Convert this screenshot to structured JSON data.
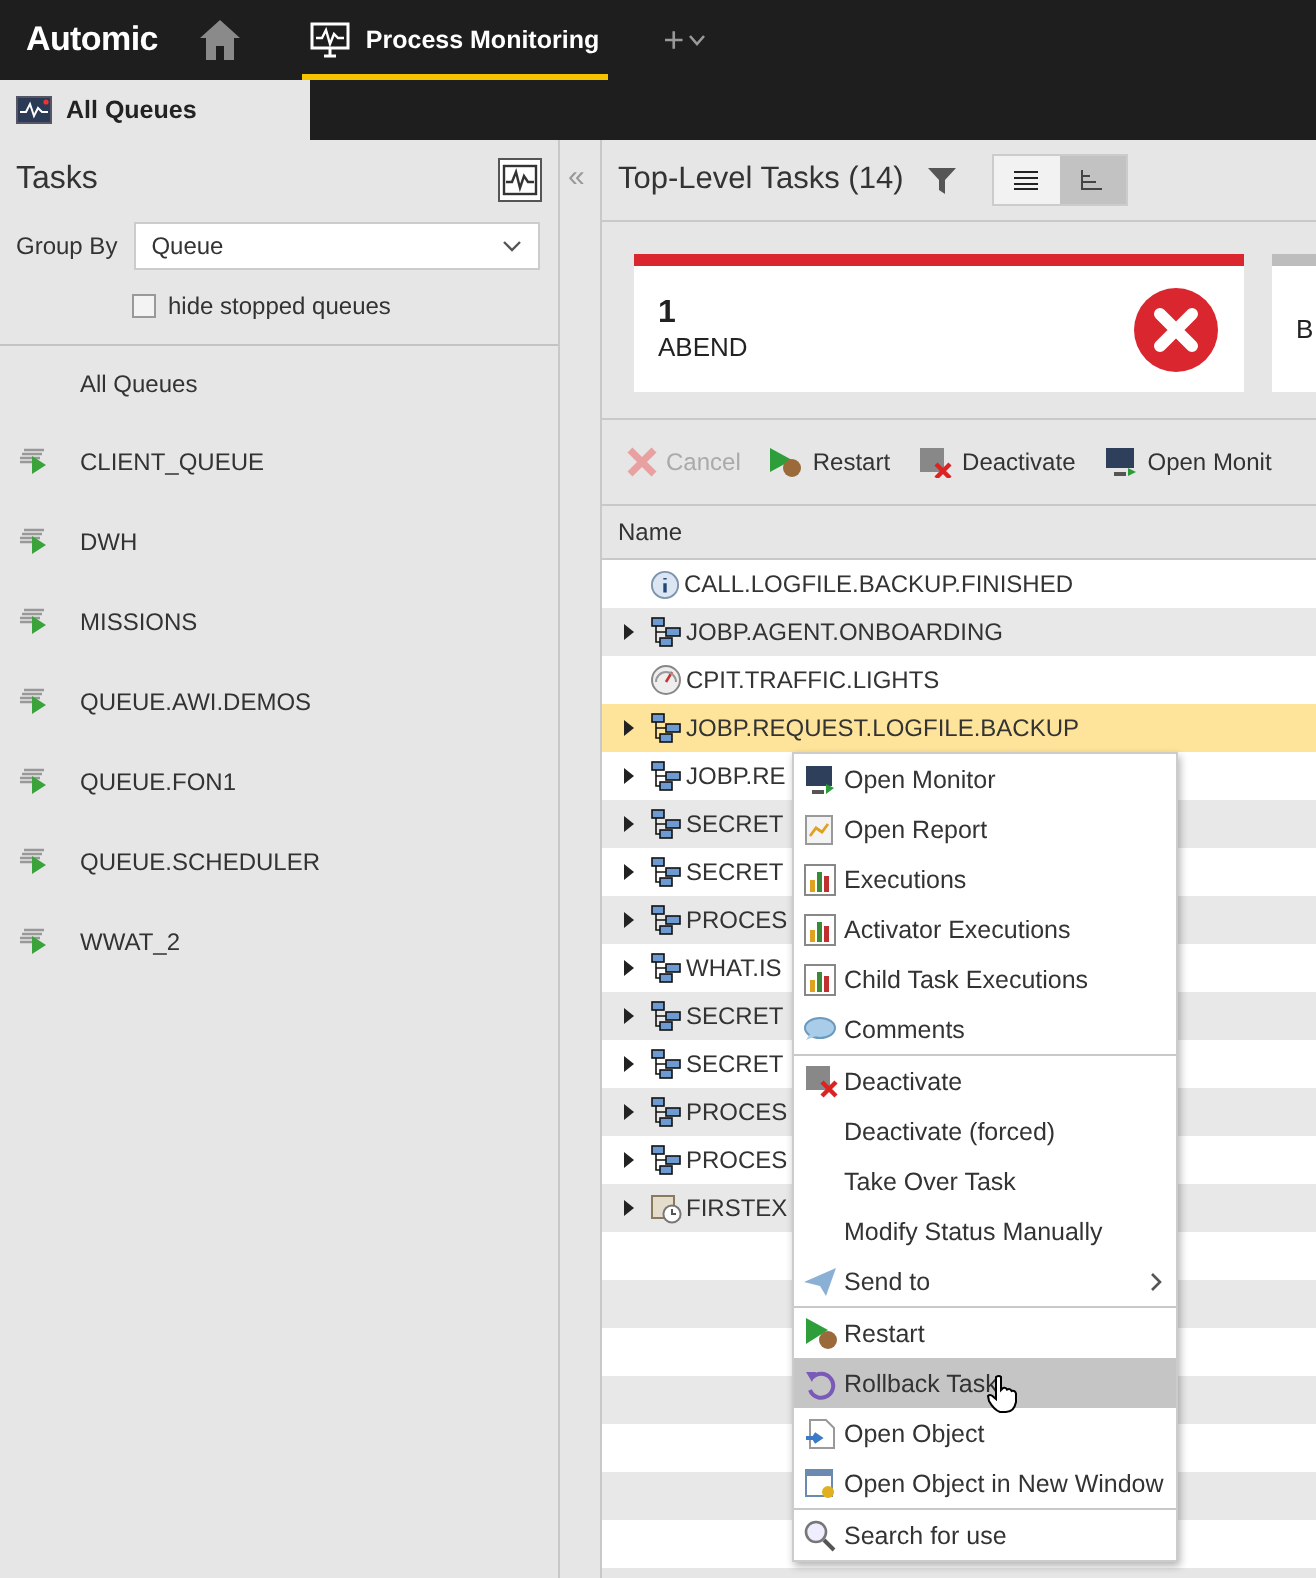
{
  "topbar": {
    "logo": "Automic",
    "tabs": [
      {
        "label": "Process Monitoring",
        "selected": true
      }
    ],
    "add": "+"
  },
  "view_tab": {
    "label": "All Queues",
    "selected": true
  },
  "left": {
    "title": "Tasks",
    "group_by_label": "Group By",
    "group_by_value": "Queue",
    "hide_stopped": {
      "label": "hide stopped queues",
      "checked": false
    },
    "queues": [
      {
        "label": "All Queues",
        "kind": "all"
      },
      {
        "label": "CLIENT_QUEUE",
        "kind": "queue"
      },
      {
        "label": "DWH",
        "kind": "queue"
      },
      {
        "label": "MISSIONS",
        "kind": "queue"
      },
      {
        "label": "QUEUE.AWI.DEMOS",
        "kind": "queue"
      },
      {
        "label": "QUEUE.FON1",
        "kind": "queue"
      },
      {
        "label": "QUEUE.SCHEDULER",
        "kind": "queue"
      },
      {
        "label": "WWAT_2",
        "kind": "queue"
      }
    ]
  },
  "collapse": "«",
  "right": {
    "title": "Top-Level Tasks (14)",
    "views": [
      {
        "kind": "list",
        "selected": false
      },
      {
        "kind": "tree",
        "selected": true
      }
    ],
    "cards": [
      {
        "count": "1",
        "label": "ABEND",
        "kind": "abend"
      },
      {
        "label": "B",
        "kind": "other"
      }
    ],
    "toolbar": [
      {
        "label": "Cancel",
        "kind": "cancel",
        "disabled": true
      },
      {
        "label": "Restart",
        "kind": "restart",
        "disabled": false
      },
      {
        "label": "Deactivate",
        "kind": "deactivate",
        "disabled": false
      },
      {
        "label": "Open Monit",
        "kind": "monitor",
        "disabled": false
      }
    ],
    "column": "Name",
    "rows": [
      {
        "name": "CALL.LOGFILE.BACKUP.FINISHED",
        "kind": "info",
        "expandable": false,
        "selected": false
      },
      {
        "name": "JOBP.AGENT.ONBOARDING",
        "kind": "workflow",
        "expandable": true,
        "selected": false
      },
      {
        "name": "CPIT.TRAFFIC.LIGHTS",
        "kind": "gauge",
        "expandable": false,
        "selected": false
      },
      {
        "name": "JOBP.REQUEST.LOGFILE.BACKUP",
        "kind": "workflow",
        "expandable": true,
        "selected": true
      },
      {
        "name": "JOBP.RE",
        "kind": "workflow",
        "expandable": true,
        "selected": false
      },
      {
        "name": "SECRET",
        "kind": "workflow",
        "expandable": true,
        "selected": false
      },
      {
        "name": "SECRET",
        "kind": "workflow",
        "expandable": true,
        "selected": false
      },
      {
        "name": "PROCES",
        "kind": "workflow",
        "expandable": true,
        "selected": false
      },
      {
        "name": "WHAT.IS",
        "kind": "workflow",
        "expandable": true,
        "selected": false
      },
      {
        "name": "SECRET",
        "kind": "workflow",
        "expandable": true,
        "selected": false
      },
      {
        "name": "SECRET",
        "kind": "workflow",
        "expandable": true,
        "selected": false
      },
      {
        "name": "PROCES",
        "kind": "workflow",
        "expandable": true,
        "selected": false
      },
      {
        "name": "PROCES",
        "kind": "workflow",
        "expandable": true,
        "selected": false
      },
      {
        "name": "FIRSTEX",
        "kind": "schedule",
        "expandable": true,
        "selected": false
      }
    ]
  },
  "context_menu": {
    "groups": [
      [
        {
          "label": "Open Monitor",
          "kind": "monitor",
          "selected": false,
          "submenu": false
        },
        {
          "label": "Open Report",
          "kind": "report",
          "selected": false,
          "submenu": false
        },
        {
          "label": "Executions",
          "kind": "chart",
          "selected": false,
          "submenu": false
        },
        {
          "label": "Activator Executions",
          "kind": "chart",
          "selected": false,
          "submenu": false
        },
        {
          "label": "Child Task Executions",
          "kind": "chart",
          "selected": false,
          "submenu": false
        },
        {
          "label": "Comments",
          "kind": "comment",
          "selected": false,
          "submenu": false
        }
      ],
      [
        {
          "label": "Deactivate",
          "kind": "deactivate",
          "selected": false,
          "submenu": false
        },
        {
          "label": "Deactivate (forced)",
          "kind": "plain",
          "selected": false,
          "submenu": false
        },
        {
          "label": "Take Over Task",
          "kind": "plain",
          "selected": false,
          "submenu": false
        },
        {
          "label": "Modify Status Manually",
          "kind": "plain",
          "selected": false,
          "submenu": false
        },
        {
          "label": "Send to",
          "kind": "send",
          "selected": false,
          "submenu": true
        }
      ],
      [
        {
          "label": "Restart",
          "kind": "restart",
          "selected": false,
          "submenu": false
        },
        {
          "label": "Rollback Task",
          "kind": "rollback",
          "selected": true,
          "submenu": false
        },
        {
          "label": "Open Object",
          "kind": "open",
          "selected": false,
          "submenu": false
        },
        {
          "label": "Open Object in New Window",
          "kind": "window",
          "selected": false,
          "submenu": false
        }
      ],
      [
        {
          "label": "Search for use",
          "kind": "search",
          "selected": false,
          "submenu": false
        }
      ]
    ]
  }
}
